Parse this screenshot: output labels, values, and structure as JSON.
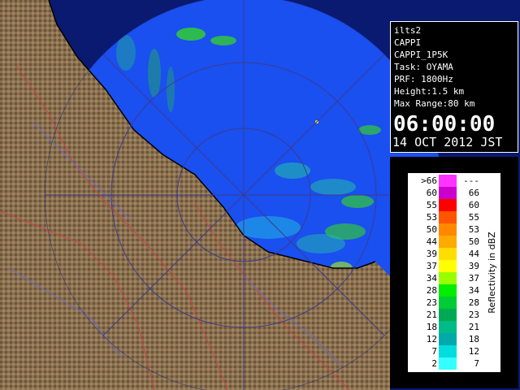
{
  "radar": {
    "station": "ilts2",
    "product": "CAPPI",
    "product_code": "CAPPI_1P5K",
    "task": "Task: OYAMA",
    "prf": "PRF: 1800Hz",
    "height": "Height:1.5 km",
    "max_range": "Max Range:80 km",
    "time": "06:00:00",
    "date": "14 OCT 2012 JST"
  },
  "legend": {
    "title": "Reflectivity in dBZ",
    "rows": [
      {
        "left": ">66",
        "right": "---",
        "color": "#ff33ff"
      },
      {
        "left": "60",
        "right": "66",
        "color": "#cc00cc"
      },
      {
        "left": "55",
        "right": "60",
        "color": "#ff0000"
      },
      {
        "left": "53",
        "right": "55",
        "color": "#ff5500"
      },
      {
        "left": "50",
        "right": "53",
        "color": "#ff8800"
      },
      {
        "left": "44",
        "right": "50",
        "color": "#ffaa00"
      },
      {
        "left": "39",
        "right": "44",
        "color": "#ffdd00"
      },
      {
        "left": "37",
        "right": "39",
        "color": "#ffff00"
      },
      {
        "left": "34",
        "right": "37",
        "color": "#99ff00"
      },
      {
        "left": "28",
        "right": "34",
        "color": "#00ee00"
      },
      {
        "left": "23",
        "right": "28",
        "color": "#00cc33"
      },
      {
        "left": "21",
        "right": "23",
        "color": "#00aa55"
      },
      {
        "left": "18",
        "right": "21",
        "color": "#00bb88"
      },
      {
        "left": "12",
        "right": "18",
        "color": "#00aaaa"
      },
      {
        "left": "7",
        "right": "12",
        "color": "#00dddd"
      },
      {
        "left": "2",
        "right": "7",
        "color": "#33ffff"
      }
    ]
  },
  "colors": {
    "radar_circle": "#1a4ff0",
    "land": "#8a7050",
    "sea_outside": "#0a1a70",
    "grid_lines": "#3c3c8c"
  }
}
